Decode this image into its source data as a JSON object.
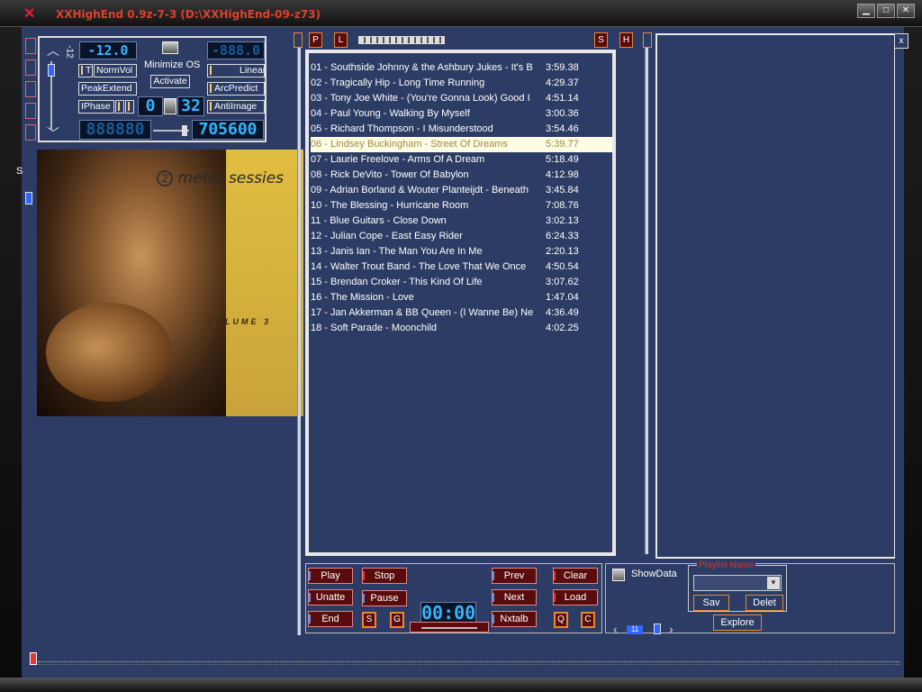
{
  "window": {
    "title": "XXHighEnd 0.9z-7-3 (D:\\XXHighEnd-09-z73)"
  },
  "controls": {
    "minimize_os_label": "Minimize OS",
    "activate_label": "Activate",
    "vol_scale_label": "-12",
    "lcd_left_top": "-12.0",
    "lcd_right_top": "-888.0",
    "lcd_mid_a": "0",
    "lcd_mid_b": "32",
    "lcd_bottom_left": "888880",
    "lcd_bottom_right": "705600",
    "toggles_left": [
      "T",
      "NormVol",
      "PeakExtend",
      "IPhase"
    ],
    "toggles_right": [
      "Linear",
      "ArcPredict",
      "AntiImage"
    ],
    "left_stub": "S"
  },
  "album_art": {
    "title": "meter sessies",
    "number": "2",
    "volume": "VOLUME 3"
  },
  "playlist_buttons": {
    "p": "P",
    "l": "L",
    "s": "S",
    "h": "H",
    "close": "x"
  },
  "playlist": {
    "selected_index": 5,
    "tracks": [
      {
        "name": "01 - Southside Johnny & the Ashbury Jukes - It's B",
        "duration": "3:59.38"
      },
      {
        "name": "02 - Tragically Hip - Long Time Running",
        "duration": "4:29.37"
      },
      {
        "name": "03 - Tony Joe White - (You're Gonna Look) Good I",
        "duration": "4:51.14"
      },
      {
        "name": "04 - Paul Young - Walking By Myself",
        "duration": "3:00.36"
      },
      {
        "name": "05 - Richard Thompson - I Misunderstood",
        "duration": "3:54.46"
      },
      {
        "name": "06 - Lindsey Buckingham - Street Of Dreams",
        "duration": "5:39.77"
      },
      {
        "name": "07 - Laurie Freelove - Arms Of A Dream",
        "duration": "5:18.49"
      },
      {
        "name": "08 - Rick DeVito - Tower Of Babylon",
        "duration": "4:12.98"
      },
      {
        "name": "09 - Adrian Borland & Wouter Planteijdt - Beneath",
        "duration": "3:45.84"
      },
      {
        "name": "10 - The Blessing - Hurricane Room",
        "duration": "7:08.76"
      },
      {
        "name": "11 - Blue Guitars - Close Down",
        "duration": "3:02.13"
      },
      {
        "name": "12 - Julian Cope - East Easy Rider",
        "duration": "6:24.33"
      },
      {
        "name": "13 - Janis Ian - The Man You Are In Me",
        "duration": "2:20.13"
      },
      {
        "name": "14 - Walter Trout Band - The Love That We Once",
        "duration": "4:50.54"
      },
      {
        "name": "15 - Brendan Croker - This Kind Of Life",
        "duration": "3:07.62"
      },
      {
        "name": "16 - The Mission - Love",
        "duration": "1:47.04"
      },
      {
        "name": "17 - Jan Akkerman & BB Queen - (I Wanne Be) Ne",
        "duration": "4:36.49"
      },
      {
        "name": "18 - Soft Parade - Moonchild",
        "duration": "4:02.25"
      }
    ]
  },
  "transport": {
    "play": "Play",
    "stop": "Stop",
    "prev": "Prev",
    "clear": "Clear",
    "unatte": "Unatte",
    "pause": "Pause",
    "next": "Next",
    "load": "Load",
    "end": "End",
    "nxtalb": "Nxtalb",
    "s": "S",
    "g": "G",
    "q": "Q",
    "c": "C",
    "time": "00:00"
  },
  "showdata": {
    "label": "ShowData",
    "playlist_name_legend": "Playlist Name",
    "save": "Sav",
    "delete": "Delet",
    "explore": "Explore",
    "page": "11"
  },
  "colors": {
    "panel_bg": "#2c3c64",
    "accent_red": "#e0402a",
    "lcd_blue": "#33b4ff",
    "button_bg": "#5a0c0c"
  }
}
